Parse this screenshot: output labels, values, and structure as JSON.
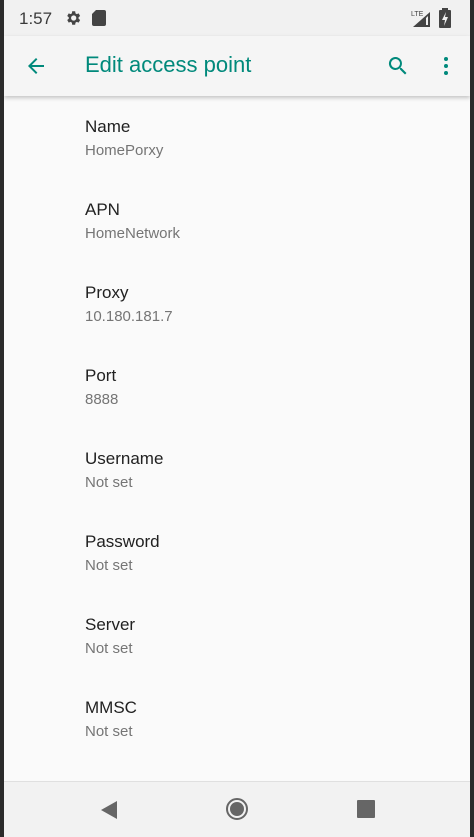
{
  "status_bar": {
    "time": "1:57",
    "icons": [
      "gear-icon",
      "sd-card-icon",
      "lte-signal-icon",
      "battery-charging-icon"
    ]
  },
  "app_bar": {
    "title": "Edit access point",
    "icons": [
      "back-arrow-icon",
      "search-icon",
      "more-vert-icon"
    ],
    "accent_color": "#00897b"
  },
  "fields": [
    {
      "title": "Name",
      "summary": "HomePorxy"
    },
    {
      "title": "APN",
      "summary": "HomeNetwork"
    },
    {
      "title": "Proxy",
      "summary": "10.180.181.7"
    },
    {
      "title": "Port",
      "summary": "8888"
    },
    {
      "title": "Username",
      "summary": "Not set"
    },
    {
      "title": "Password",
      "summary": "Not set"
    },
    {
      "title": "Server",
      "summary": "Not set"
    },
    {
      "title": "MMSC",
      "summary": "Not set"
    }
  ],
  "nav_bar": {
    "icons": [
      "nav-back-icon",
      "nav-home-icon",
      "nav-recents-icon"
    ]
  }
}
